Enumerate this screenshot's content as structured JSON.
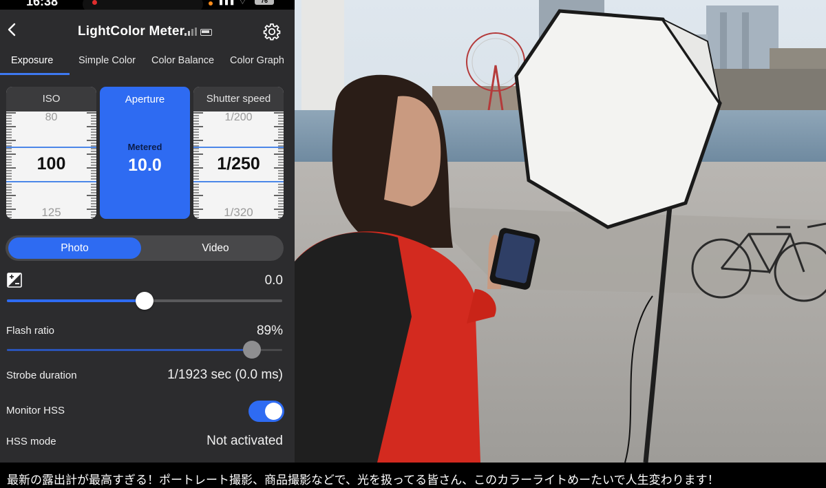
{
  "status": {
    "time": "16:38",
    "battery": "76"
  },
  "header": {
    "title": "LightColor Meter"
  },
  "tabs": [
    "Exposure",
    "Simple Color",
    "Color Balance",
    "Color Graph"
  ],
  "dials": {
    "iso": {
      "label": "ISO",
      "prev": "80",
      "current": "100",
      "next": "125"
    },
    "aperture": {
      "label": "Aperture",
      "sub": "Metered",
      "value": "10.0"
    },
    "shutter": {
      "label": "Shutter speed",
      "prev": "1/200",
      "current": "1/250",
      "next": "1/320"
    }
  },
  "mode": {
    "photo": "Photo",
    "video": "Video"
  },
  "exposure_compensation": {
    "value": "0.0",
    "level": 0.5
  },
  "flash_ratio": {
    "label": "Flash ratio",
    "value": "89%",
    "level": 0.89
  },
  "strobe": {
    "label": "Strobe duration",
    "value": "1/1923 sec (0.0 ms)"
  },
  "hss_monitor": {
    "label": "Monitor HSS",
    "on": true
  },
  "hss_mode": {
    "label": "HSS mode",
    "value": "Not activated"
  },
  "caption": "最新の露出計が最高すぎる！ポートレート撮影、商品撮影などで、光を扱ってる皆さん、このカラーライトめーたいで人生変わります！",
  "colors": {
    "accent": "#2e6bf2",
    "panel": "#2c2c2e"
  }
}
